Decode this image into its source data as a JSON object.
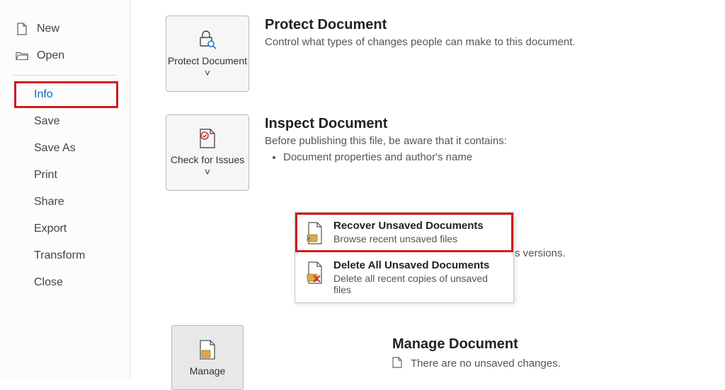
{
  "sidebar": {
    "new": "New",
    "open": "Open",
    "info": "Info",
    "save": "Save",
    "save_as": "Save As",
    "print": "Print",
    "share": "Share",
    "export": "Export",
    "transform": "Transform",
    "close": "Close"
  },
  "protect": {
    "tile_label": "Protect Document ˅",
    "heading": "Protect Document",
    "desc": "Control what types of changes people can make to this document."
  },
  "inspect": {
    "tile_label": "Check for Issues ˅",
    "heading": "Inspect Document",
    "desc": "Before publishing this file, be aware that it contains:",
    "item1": "Document properties and author's name"
  },
  "popup": {
    "recover_title": "Recover Unsaved Documents",
    "recover_desc": "Browse recent unsaved files",
    "delete_title": "Delete All Unsaved Documents",
    "delete_desc": "Delete all recent copies of unsaved files"
  },
  "manage": {
    "tile_label": "Manage",
    "heading": "Manage Document",
    "no_unsaved": "There are no unsaved changes."
  },
  "trailing": "s versions."
}
